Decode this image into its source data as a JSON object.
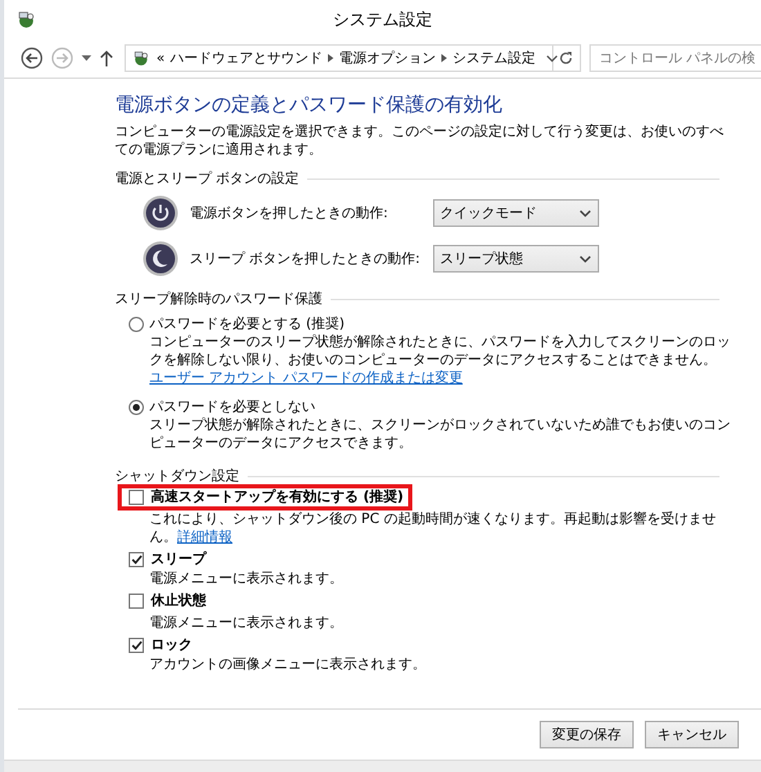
{
  "window": {
    "title": "システム設定"
  },
  "address_bar": {
    "overflow": "«",
    "breadcrumbs": [
      "ハードウェアとサウンド",
      "電源オプション",
      "システム設定"
    ]
  },
  "search": {
    "placeholder": "コントロール パネルの検"
  },
  "heading": "電源ボタンの定義とパスワード保護の有効化",
  "intro": "コンピューターの電源設定を選択できます。このページの設定に対して行う変更は、お使いのすべての電源プランに適用されます。",
  "button_settings": {
    "title": "電源とスリープ ボタンの設定",
    "rows": [
      {
        "kind": "power",
        "label": "電源ボタンを押したときの動作:",
        "value": "クイックモード"
      },
      {
        "kind": "sleep",
        "label": "スリープ ボタンを押したときの動作:",
        "value": "スリープ状態"
      }
    ]
  },
  "password_protection": {
    "title": "スリープ解除時のパスワード保護",
    "options": [
      {
        "label": "パスワードを必要とする (推奨)",
        "description": "コンピューターのスリープ状態が解除されたときに、パスワードを入力してスクリーンのロックを解除しない限り、お使いのコンピューターのデータにアクセスすることはできません。",
        "link": "ユーザー アカウント パスワードの作成または変更",
        "selected": false
      },
      {
        "label": "パスワードを必要としない",
        "description": "スリープ状態が解除されたときに、スクリーンがロックされていないため誰でもお使いのコンピューターのデータにアクセスできます。",
        "selected": true
      }
    ]
  },
  "shutdown_settings": {
    "title": "シャットダウン設定",
    "items": [
      {
        "label": "高速スタートアップを有効にする (推奨)",
        "description": "これにより、シャットダウン後の PC の起動時間が速くなります。再起動は影響を受けません。",
        "link": "詳細情報",
        "checked": false,
        "highlighted": true
      },
      {
        "label": "スリープ",
        "description": "電源メニューに表示されます。",
        "checked": true,
        "highlighted": false
      },
      {
        "label": "休止状態",
        "description": "電源メニューに表示されます。",
        "checked": false,
        "highlighted": false
      },
      {
        "label": "ロック",
        "description": "アカウントの画像メニューに表示されます。",
        "checked": true,
        "highlighted": false
      }
    ]
  },
  "buttons": [
    "変更の保存",
    "キャンセル"
  ]
}
